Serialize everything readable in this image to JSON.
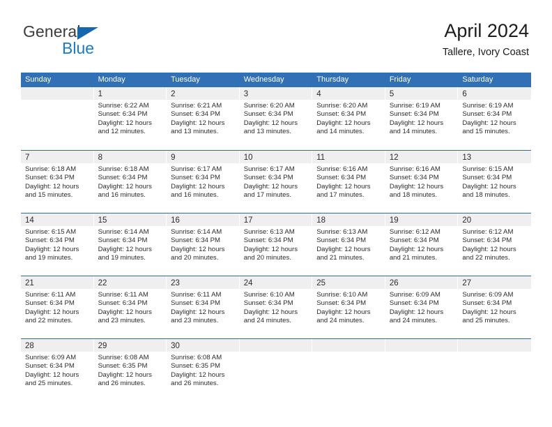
{
  "brand": {
    "name_top": "General",
    "name_bottom": "Blue",
    "flag_color": "#1667b0",
    "blue_text_color": "#1a7bc4"
  },
  "header": {
    "title": "April 2024",
    "subtitle": "Tallere, Ivory Coast"
  },
  "theme": {
    "header_blue": "#3170b4",
    "divider_blue": "#2d6cad",
    "daynum_band": "#efefef",
    "text": "#2b2b2b"
  },
  "weekdays": [
    "Sunday",
    "Monday",
    "Tuesday",
    "Wednesday",
    "Thursday",
    "Friday",
    "Saturday"
  ],
  "weeks": [
    [
      {
        "day": "",
        "lines": []
      },
      {
        "day": "1",
        "lines": [
          "Sunrise: 6:22 AM",
          "Sunset: 6:34 PM",
          "Daylight: 12 hours",
          "and 12 minutes."
        ]
      },
      {
        "day": "2",
        "lines": [
          "Sunrise: 6:21 AM",
          "Sunset: 6:34 PM",
          "Daylight: 12 hours",
          "and 13 minutes."
        ]
      },
      {
        "day": "3",
        "lines": [
          "Sunrise: 6:20 AM",
          "Sunset: 6:34 PM",
          "Daylight: 12 hours",
          "and 13 minutes."
        ]
      },
      {
        "day": "4",
        "lines": [
          "Sunrise: 6:20 AM",
          "Sunset: 6:34 PM",
          "Daylight: 12 hours",
          "and 14 minutes."
        ]
      },
      {
        "day": "5",
        "lines": [
          "Sunrise: 6:19 AM",
          "Sunset: 6:34 PM",
          "Daylight: 12 hours",
          "and 14 minutes."
        ]
      },
      {
        "day": "6",
        "lines": [
          "Sunrise: 6:19 AM",
          "Sunset: 6:34 PM",
          "Daylight: 12 hours",
          "and 15 minutes."
        ]
      }
    ],
    [
      {
        "day": "7",
        "lines": [
          "Sunrise: 6:18 AM",
          "Sunset: 6:34 PM",
          "Daylight: 12 hours",
          "and 15 minutes."
        ]
      },
      {
        "day": "8",
        "lines": [
          "Sunrise: 6:18 AM",
          "Sunset: 6:34 PM",
          "Daylight: 12 hours",
          "and 16 minutes."
        ]
      },
      {
        "day": "9",
        "lines": [
          "Sunrise: 6:17 AM",
          "Sunset: 6:34 PM",
          "Daylight: 12 hours",
          "and 16 minutes."
        ]
      },
      {
        "day": "10",
        "lines": [
          "Sunrise: 6:17 AM",
          "Sunset: 6:34 PM",
          "Daylight: 12 hours",
          "and 17 minutes."
        ]
      },
      {
        "day": "11",
        "lines": [
          "Sunrise: 6:16 AM",
          "Sunset: 6:34 PM",
          "Daylight: 12 hours",
          "and 17 minutes."
        ]
      },
      {
        "day": "12",
        "lines": [
          "Sunrise: 6:16 AM",
          "Sunset: 6:34 PM",
          "Daylight: 12 hours",
          "and 18 minutes."
        ]
      },
      {
        "day": "13",
        "lines": [
          "Sunrise: 6:15 AM",
          "Sunset: 6:34 PM",
          "Daylight: 12 hours",
          "and 18 minutes."
        ]
      }
    ],
    [
      {
        "day": "14",
        "lines": [
          "Sunrise: 6:15 AM",
          "Sunset: 6:34 PM",
          "Daylight: 12 hours",
          "and 19 minutes."
        ]
      },
      {
        "day": "15",
        "lines": [
          "Sunrise: 6:14 AM",
          "Sunset: 6:34 PM",
          "Daylight: 12 hours",
          "and 19 minutes."
        ]
      },
      {
        "day": "16",
        "lines": [
          "Sunrise: 6:14 AM",
          "Sunset: 6:34 PM",
          "Daylight: 12 hours",
          "and 20 minutes."
        ]
      },
      {
        "day": "17",
        "lines": [
          "Sunrise: 6:13 AM",
          "Sunset: 6:34 PM",
          "Daylight: 12 hours",
          "and 20 minutes."
        ]
      },
      {
        "day": "18",
        "lines": [
          "Sunrise: 6:13 AM",
          "Sunset: 6:34 PM",
          "Daylight: 12 hours",
          "and 21 minutes."
        ]
      },
      {
        "day": "19",
        "lines": [
          "Sunrise: 6:12 AM",
          "Sunset: 6:34 PM",
          "Daylight: 12 hours",
          "and 21 minutes."
        ]
      },
      {
        "day": "20",
        "lines": [
          "Sunrise: 6:12 AM",
          "Sunset: 6:34 PM",
          "Daylight: 12 hours",
          "and 22 minutes."
        ]
      }
    ],
    [
      {
        "day": "21",
        "lines": [
          "Sunrise: 6:11 AM",
          "Sunset: 6:34 PM",
          "Daylight: 12 hours",
          "and 22 minutes."
        ]
      },
      {
        "day": "22",
        "lines": [
          "Sunrise: 6:11 AM",
          "Sunset: 6:34 PM",
          "Daylight: 12 hours",
          "and 23 minutes."
        ]
      },
      {
        "day": "23",
        "lines": [
          "Sunrise: 6:11 AM",
          "Sunset: 6:34 PM",
          "Daylight: 12 hours",
          "and 23 minutes."
        ]
      },
      {
        "day": "24",
        "lines": [
          "Sunrise: 6:10 AM",
          "Sunset: 6:34 PM",
          "Daylight: 12 hours",
          "and 24 minutes."
        ]
      },
      {
        "day": "25",
        "lines": [
          "Sunrise: 6:10 AM",
          "Sunset: 6:34 PM",
          "Daylight: 12 hours",
          "and 24 minutes."
        ]
      },
      {
        "day": "26",
        "lines": [
          "Sunrise: 6:09 AM",
          "Sunset: 6:34 PM",
          "Daylight: 12 hours",
          "and 24 minutes."
        ]
      },
      {
        "day": "27",
        "lines": [
          "Sunrise: 6:09 AM",
          "Sunset: 6:34 PM",
          "Daylight: 12 hours",
          "and 25 minutes."
        ]
      }
    ],
    [
      {
        "day": "28",
        "lines": [
          "Sunrise: 6:09 AM",
          "Sunset: 6:34 PM",
          "Daylight: 12 hours",
          "and 25 minutes."
        ]
      },
      {
        "day": "29",
        "lines": [
          "Sunrise: 6:08 AM",
          "Sunset: 6:35 PM",
          "Daylight: 12 hours",
          "and 26 minutes."
        ]
      },
      {
        "day": "30",
        "lines": [
          "Sunrise: 6:08 AM",
          "Sunset: 6:35 PM",
          "Daylight: 12 hours",
          "and 26 minutes."
        ]
      },
      {
        "day": "",
        "lines": []
      },
      {
        "day": "",
        "lines": []
      },
      {
        "day": "",
        "lines": []
      },
      {
        "day": "",
        "lines": []
      }
    ]
  ]
}
